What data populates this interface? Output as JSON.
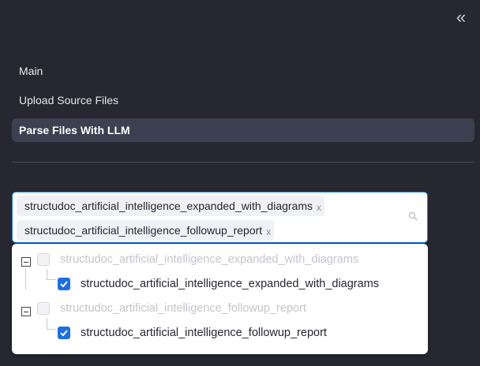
{
  "sidebar": {
    "collapse_glyph": "«",
    "nav": [
      {
        "label": "Main"
      },
      {
        "label": "Upload Source Files"
      },
      {
        "label": "Parse Files With LLM"
      }
    ]
  },
  "multiselect": {
    "selected": [
      "structudoc_artificial_intelligence_expanded_with_diagrams",
      "structudoc_artificial_intelligence_followup_report"
    ],
    "remove_glyph": "x"
  },
  "tree": {
    "groups": [
      {
        "label": "structudoc_artificial_intelligence_expanded_with_diagrams",
        "child": "structudoc_artificial_intelligence_expanded_with_diagrams"
      },
      {
        "label": "structudoc_artificial_intelligence_followup_report",
        "child": "structudoc_artificial_intelligence_followup_report"
      }
    ]
  },
  "colors": {
    "sidebar_bg": "#262730",
    "active_item_bg": "#3d4050",
    "accent_blue": "#1c6fe0",
    "focus_border": "#1c83e1"
  }
}
